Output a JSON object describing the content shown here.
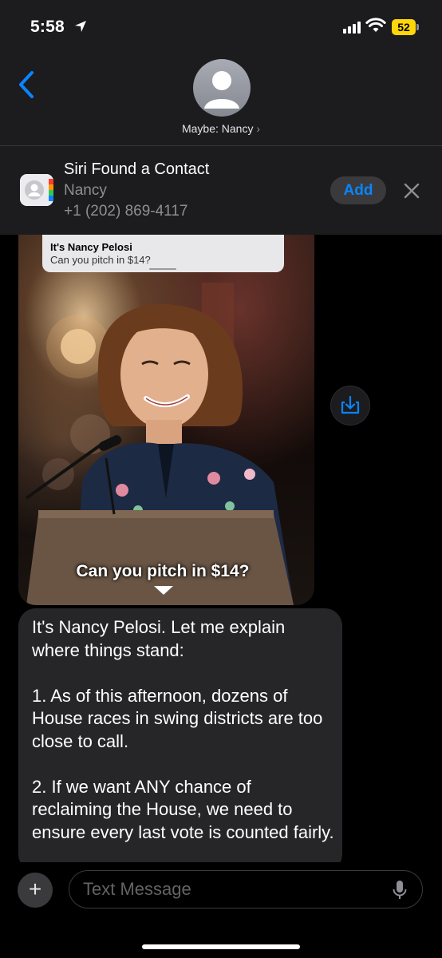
{
  "status_bar": {
    "time": "5:58",
    "battery": "52"
  },
  "header": {
    "contact_label": "Maybe: Nancy",
    "chevron": "›"
  },
  "siri_banner": {
    "title": "Siri Found a Contact",
    "name": "Nancy",
    "phone": "+1 (202) 869-4117",
    "add_label": "Add"
  },
  "image_message": {
    "notification_title": "It's Nancy Pelosi",
    "notification_subtitle": "Can you pitch in $14?",
    "caption": "Can you pitch in $14?"
  },
  "text_message": {
    "body": "It's Nancy Pelosi. Let me explain where things stand:\n\n1. As of this afternoon, dozens of House races in swing districts are too close to call.\n\n2. If we want ANY chance of reclaiming the House, we need to ensure every last vote is counted fairly."
  },
  "input": {
    "placeholder": "Text Message",
    "plus_label": "+"
  },
  "icons": [
    "location-arrow-icon",
    "signal-icon",
    "wifi-icon",
    "back-chevron-icon",
    "person-icon",
    "contacts-app-icon",
    "close-icon",
    "save-download-icon",
    "mic-icon"
  ],
  "colors": {
    "accent": "#0a84ff",
    "battery": "#ffd60a",
    "bubble": "#262628"
  }
}
